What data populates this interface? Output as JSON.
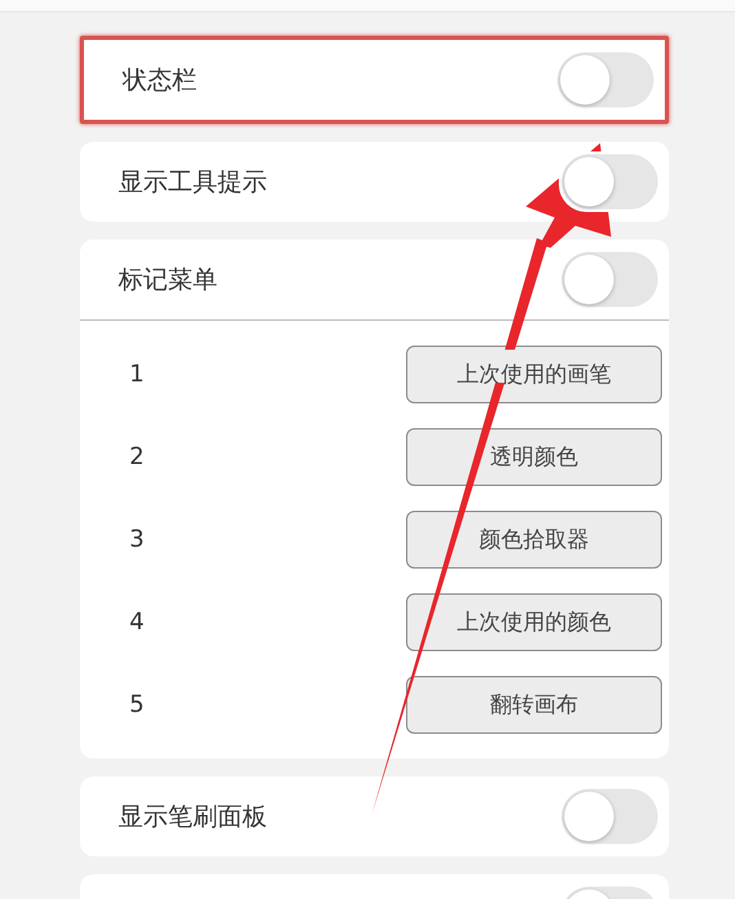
{
  "settings": [
    {
      "kind": "toggle",
      "label": "状态栏",
      "on": false,
      "highlighted": true
    },
    {
      "kind": "toggle",
      "label": "显示工具提示",
      "on": false,
      "highlighted": false
    },
    {
      "kind": "menu",
      "label": "标记菜单",
      "on": false,
      "highlighted": false,
      "slots": [
        {
          "number": "1",
          "action": "上次使用的画笔"
        },
        {
          "number": "2",
          "action": "透明颜色"
        },
        {
          "number": "3",
          "action": "颜色拾取器"
        },
        {
          "number": "4",
          "action": "上次使用的颜色"
        },
        {
          "number": "5",
          "action": "翻转画布"
        }
      ]
    },
    {
      "kind": "toggle",
      "label": "显示笔刷面板",
      "on": false,
      "highlighted": false
    },
    {
      "kind": "toggle",
      "on": false,
      "highlighted": false
    }
  ],
  "annotation_arrow": true
}
